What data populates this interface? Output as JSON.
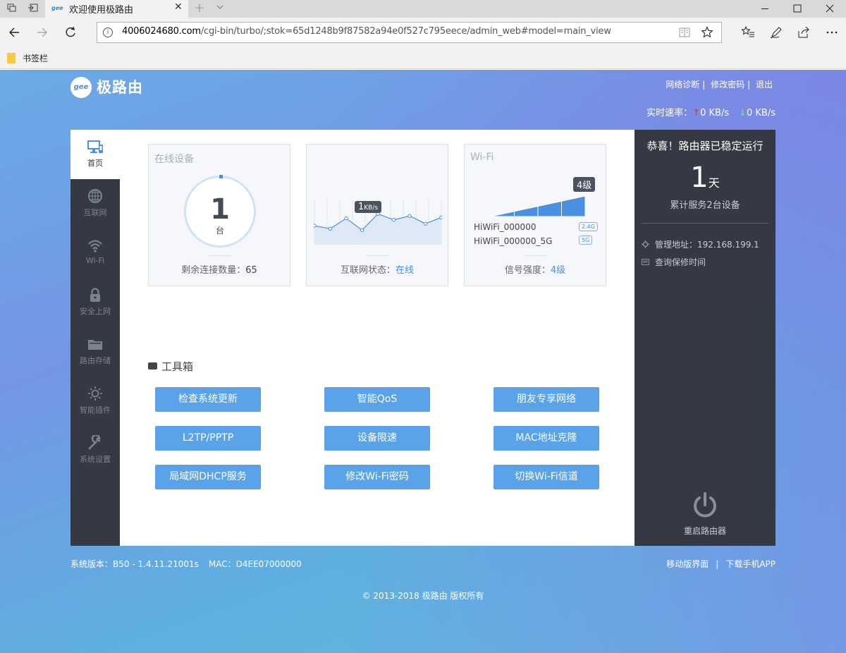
{
  "browser": {
    "tab_title": "欢迎使用极路由",
    "tab_favicon": "gee",
    "url_host": "4006024680.com",
    "url_path": "/cgi-bin/turbo/;stok=65d1248b9f87582a94e0f527c795eece/admin_web#model=main_view",
    "bookmarks_label": "书签栏"
  },
  "header": {
    "logo_mark": "gee",
    "logo_text": "极路由",
    "links": [
      "网络诊断",
      "修改密码",
      "退出"
    ],
    "speed_label": "实时速率：",
    "speed_up": "0 KB/s",
    "speed_down": "0 KB/s"
  },
  "sidebar": {
    "items": [
      {
        "label": "首页",
        "icon": "monitor-icon",
        "active": true
      },
      {
        "label": "互联网",
        "icon": "globe-icon"
      },
      {
        "label": "Wi-Fi",
        "icon": "wifi-icon"
      },
      {
        "label": "安全上网",
        "icon": "lock-icon"
      },
      {
        "label": "路由存储",
        "icon": "folder-icon"
      },
      {
        "label": "智能插件",
        "icon": "sun-icon"
      },
      {
        "label": "系统设置",
        "icon": "wrench-icon"
      }
    ]
  },
  "cards": {
    "devices": {
      "title": "在线设备",
      "count": "1",
      "unit": "台",
      "foot_label": "剩余连接数量：",
      "foot_value": "65"
    },
    "internet": {
      "speed_tag_num": "1",
      "speed_tag_unit": "KB/s",
      "foot_label": "互联网状态：",
      "foot_value": "在线",
      "traffic": [
        0.45,
        0.35,
        0.7,
        0.3,
        0.85,
        0.65,
        0.78,
        0.52,
        0.73
      ]
    },
    "wifi": {
      "title": "Wi-Fi",
      "level_tag": "4级",
      "ssid_24": "HiWiFi_000000",
      "band_24": "2.4G",
      "ssid_5": "HiWiFi_000000_5G",
      "band_5": "5G",
      "foot_label": "信号强度：",
      "foot_value": "4级",
      "level": 4,
      "max_level": 4
    }
  },
  "toolbox": {
    "title": "工具箱",
    "buttons": [
      "检查系统更新",
      "智能QoS",
      "朋友专享网络",
      "L2TP/PPTP",
      "设备限速",
      "MAC地址克隆",
      "局域网DHCP服务",
      "修改Wi-Fi密码",
      "切换Wi-Fi信道"
    ]
  },
  "status": {
    "title": "恭喜！路由器已稳定运行",
    "days": "1",
    "days_unit": "天",
    "sub": "累计服务2台设备",
    "admin_label": "管理地址：192.168.199.1",
    "warranty_label": "查询保修时间",
    "reboot_label": "重启路由器"
  },
  "footer": {
    "version": "系统版本：B50 - 1.4.11.21001s",
    "mac": "MAC：D4EE07000000",
    "mobile": "移动版界面",
    "app": "下载手机APP",
    "copyright": "© 2013-2018 极路由 版权所有"
  },
  "colors": {
    "accent": "#4a90e2",
    "sidebar_bg": "#353943",
    "button": "#5aa3e8"
  }
}
